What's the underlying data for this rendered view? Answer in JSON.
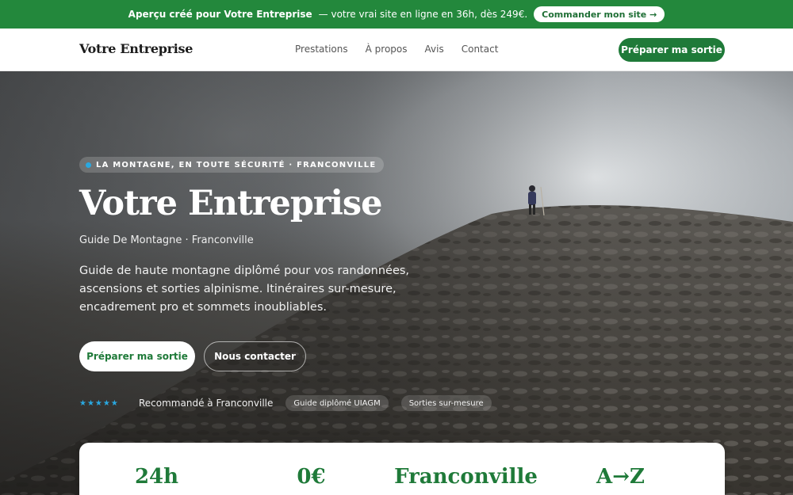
{
  "promo": {
    "prefix": "Aperçu créé pour Votre Entreprise",
    "suffix": "— votre vrai site en ligne en 36h, dès 249€.",
    "button": "Commander mon site →"
  },
  "nav": {
    "brand": "Votre Entreprise",
    "links": [
      "Prestations",
      "À propos",
      "Avis",
      "Contact"
    ],
    "cta": "Préparer ma sortie"
  },
  "hero": {
    "kicker": "LA MONTAGNE, EN TOUTE SÉCURITÉ · FRANCONVILLE",
    "title": "Votre Entreprise",
    "subtitle": "Guide De Montagne · Franconville",
    "description": "Guide de haute montagne diplômé pour vos randonnées, ascensions et sorties alpinisme. Itinéraires sur-mesure, encadrement pro et sommets inoubliables.",
    "primary_button": "Préparer ma sortie",
    "secondary_button": "Nous contacter",
    "stars": "★★★★★",
    "rating": 5,
    "trust_text": "Recommandé à Franconville",
    "chips": [
      "Guide diplômé UIAGM",
      "Sorties sur-mesure"
    ]
  },
  "stats": [
    "24h",
    "0€",
    "Franconville",
    "A→Z"
  ],
  "colors": {
    "brand_green": "#1f7a39",
    "banner_green": "#23883c",
    "accent_blue": "#2aa8e0"
  }
}
